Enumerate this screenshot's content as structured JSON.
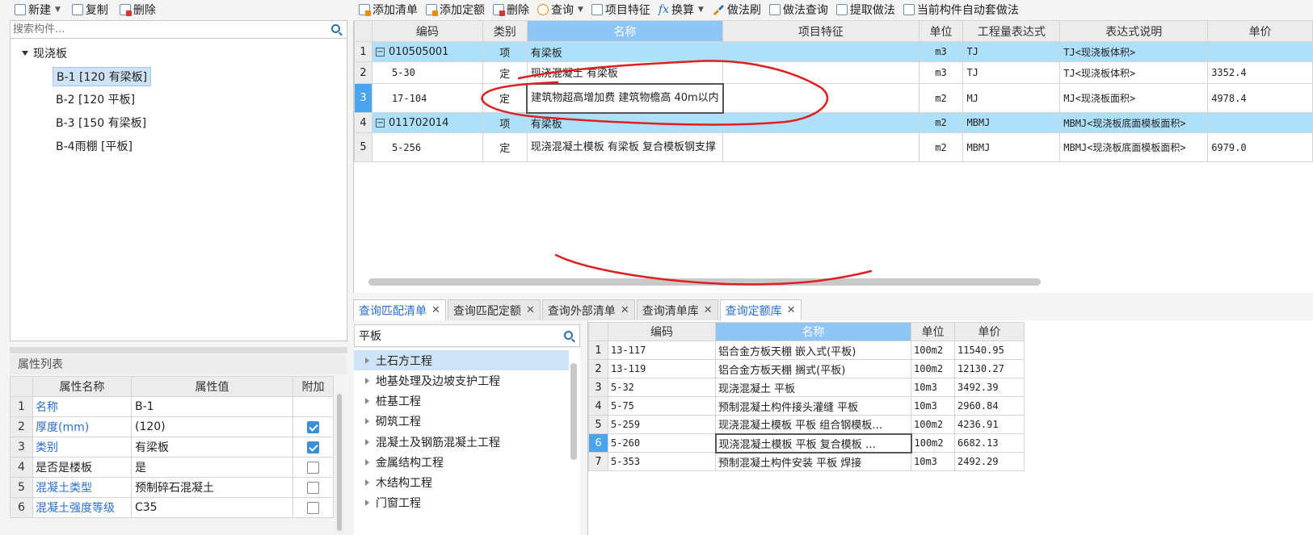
{
  "left_toolbar": {
    "items": [
      {
        "label": "新建",
        "icon": "new-icon",
        "dropdown": true
      },
      {
        "label": "复制",
        "icon": "copy-icon"
      },
      {
        "label": "删除",
        "icon": "delete-icon"
      }
    ]
  },
  "right_toolbar": {
    "items": [
      {
        "label": "添加清单",
        "icon": "add-list-icon"
      },
      {
        "label": "添加定额",
        "icon": "add-quota-icon"
      },
      {
        "label": "删除",
        "icon": "delete-icon"
      },
      {
        "label": "查询",
        "icon": "query-icon",
        "dropdown": true
      },
      {
        "label": "项目特征",
        "icon": "feature-icon"
      },
      {
        "label": "换算",
        "icon": "fx-icon",
        "dropdown": true
      },
      {
        "label": "做法刷",
        "icon": "brush-icon"
      },
      {
        "label": "做法查询",
        "icon": "method-query-icon"
      },
      {
        "label": "提取做法",
        "icon": "extract-icon"
      },
      {
        "label": "当前构件自动套做法",
        "icon": "auto-apply-icon"
      }
    ]
  },
  "tree": {
    "search_placeholder": "搜索构件...",
    "root": "现浇板",
    "children": [
      "B-1 [120 有梁板]",
      "B-2 [120 平板]",
      "B-3 [150 有梁板]",
      "B-4雨棚 [平板]"
    ],
    "selected_index": 0
  },
  "properties": {
    "title": "属性列表",
    "headers": [
      "属性名称",
      "属性值",
      "附加"
    ],
    "rows": [
      {
        "no": "1",
        "name": "名称",
        "value": "B-1",
        "blue": true,
        "check": null
      },
      {
        "no": "2",
        "name": "厚度(mm)",
        "value": "(120)",
        "blue": true,
        "check": true
      },
      {
        "no": "3",
        "name": "类别",
        "value": "有梁板",
        "blue": true,
        "check": true
      },
      {
        "no": "4",
        "name": "是否是楼板",
        "value": "是",
        "blue": false,
        "check": false
      },
      {
        "no": "5",
        "name": "混凝土类型",
        "value": "预制碎石混凝土",
        "blue": true,
        "check": false
      },
      {
        "no": "6",
        "name": "混凝土强度等级",
        "value": "C35",
        "blue": true,
        "check": false
      }
    ]
  },
  "main_grid": {
    "headers": [
      "编码",
      "类别",
      "名称",
      "项目特征",
      "单位",
      "工程量表达式",
      "表达式说明",
      "单价"
    ],
    "rows": [
      {
        "no": "1",
        "code": "010505001",
        "type": "项",
        "name": "有梁板",
        "feature": "",
        "unit": "m3",
        "expr": "TJ",
        "desc": "TJ<现浇板体积>",
        "price": "",
        "kind": "list",
        "expander": "−"
      },
      {
        "no": "2",
        "code": "5-30",
        "type": "定",
        "name": "现浇混凝土 有梁板",
        "feature": "",
        "unit": "m3",
        "expr": "TJ",
        "desc": "TJ<现浇板体积>",
        "price": "3352.4",
        "kind": "quota"
      },
      {
        "no": "3",
        "code": "17-104",
        "type": "定",
        "name": "建筑物超高增加费 建筑物檐高 40m以内",
        "feature": "",
        "unit": "m2",
        "expr": "MJ",
        "desc": "MJ<现浇板面积>",
        "price": "4978.4",
        "kind": "quota",
        "current": true
      },
      {
        "no": "4",
        "code": "011702014",
        "type": "项",
        "name": "有梁板",
        "feature": "",
        "unit": "m2",
        "expr": "MBMJ",
        "desc": "MBMJ<现浇板底面模板面积>",
        "price": "",
        "kind": "list",
        "expander": "−"
      },
      {
        "no": "5",
        "code": "5-256",
        "type": "定",
        "name": "现浇混凝土模板 有梁板 复合模板钢支撑",
        "feature": "",
        "unit": "m2",
        "expr": "MBMJ",
        "desc": "MBMJ<现浇板底面模板面积>",
        "price": "6979.0",
        "kind": "quota"
      }
    ]
  },
  "tabs": [
    {
      "label": "查询匹配清单",
      "active": true
    },
    {
      "label": "查询匹配定额",
      "active": false
    },
    {
      "label": "查询外部清单",
      "active": false
    },
    {
      "label": "查询清单库",
      "active": false
    },
    {
      "label": "查询定额库",
      "active": true
    }
  ],
  "query": {
    "search_value": "平板",
    "categories": [
      "土石方工程",
      "地基处理及边坡支护工程",
      "桩基工程",
      "砌筑工程",
      "混凝土及钢筋混凝土工程",
      "金属结构工程",
      "木结构工程",
      "门窗工程"
    ],
    "selected_category": 0
  },
  "quota_table": {
    "headers": [
      "编码",
      "名称",
      "单位",
      "单价"
    ],
    "rows": [
      {
        "no": "1",
        "code": "13-117",
        "name": "铝合金方板天棚 嵌入式(平板)",
        "unit": "100m2",
        "price": "11540.95"
      },
      {
        "no": "2",
        "code": "13-119",
        "name": "铝合金方板天棚 搁式(平板)",
        "unit": "100m2",
        "price": "12130.27"
      },
      {
        "no": "3",
        "code": "5-32",
        "name": "现浇混凝土 平板",
        "unit": "10m3",
        "price": "3492.39"
      },
      {
        "no": "4",
        "code": "5-75",
        "name": "预制混凝土构件接头灌缝 平板",
        "unit": "10m3",
        "price": "2960.84"
      },
      {
        "no": "5",
        "code": "5-259",
        "name": "现浇混凝土模板 平板 组合钢模板…",
        "unit": "100m2",
        "price": "4236.91"
      },
      {
        "no": "6",
        "code": "5-260",
        "name": "现浇混凝土模板 平板 复合模板 …",
        "unit": "100m2",
        "price": "6682.13",
        "current": true
      },
      {
        "no": "7",
        "code": "5-353",
        "name": "预制混凝土构件安装 平板 焊接",
        "unit": "10m3",
        "price": "2492.29"
      }
    ]
  },
  "colors": {
    "accent": "#4aa3ef",
    "header_active": "#8ec5f5",
    "list_row": "#aee0fb",
    "annotation": "#e02020"
  }
}
